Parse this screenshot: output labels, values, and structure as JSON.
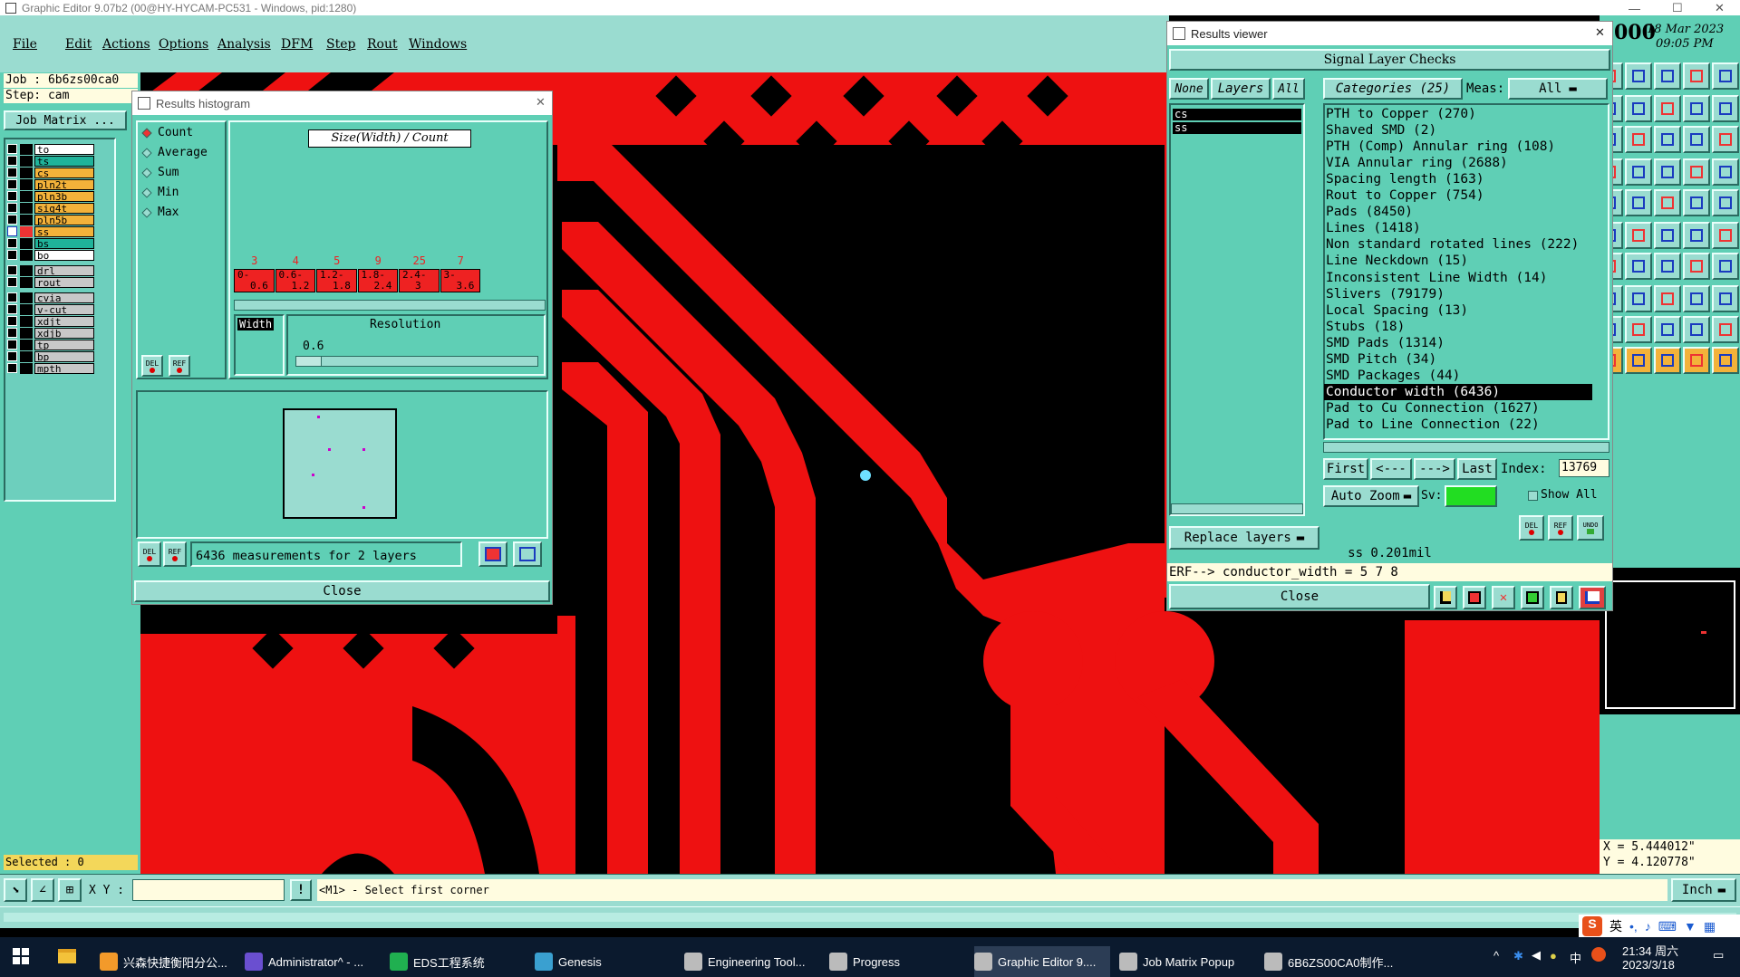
{
  "app": {
    "title": "Graphic Editor 9.07b2 (00@HY-HYCAM-PC531 - Windows, pid:1280)"
  },
  "menu": [
    "File",
    "Edit",
    "Actions",
    "Options",
    "Analysis",
    "DFM",
    "Step",
    "Rout",
    "Windows"
  ],
  "job": {
    "label": "Job :",
    "value": "6b6zs00ca0",
    "step_label": "Step:",
    "step_value": "cam",
    "matrix_label": "Job Matrix ..."
  },
  "layers": [
    {
      "name": "to",
      "color": "#ffffff"
    },
    {
      "name": "ts",
      "color": "#1fb39a"
    },
    {
      "name": "cs",
      "color": "#f3b23a"
    },
    {
      "name": "pln2t",
      "color": "#f3b23a"
    },
    {
      "name": "pln3b",
      "color": "#f3b23a"
    },
    {
      "name": "sig4t",
      "color": "#f3b23a"
    },
    {
      "name": "pln5b",
      "color": "#f3b23a"
    },
    {
      "name": "ss",
      "color": "#f3b23a"
    },
    {
      "name": "bs",
      "color": "#1fb39a"
    },
    {
      "name": "bo",
      "color": "#ffffff"
    },
    {
      "name": "drl",
      "color": "#c8c8c8"
    },
    {
      "name": "rout",
      "color": "#c8c8c8"
    },
    {
      "name": "cvia",
      "color": "#c8c8c8"
    },
    {
      "name": "v-cut",
      "color": "#c8c8c8"
    },
    {
      "name": "xdjt",
      "color": "#c8c8c8"
    },
    {
      "name": "xdjb",
      "color": "#c8c8c8"
    },
    {
      "name": "tp",
      "color": "#c8c8c8"
    },
    {
      "name": "bp",
      "color": "#c8c8c8"
    },
    {
      "name": "mpth",
      "color": "#c8c8c8"
    }
  ],
  "selected": "Selected : 0",
  "histogram": {
    "title": "Results histogram",
    "options": [
      "Count",
      "Average",
      "Sum",
      "Min",
      "Max"
    ],
    "selected_option": "Count",
    "header": "Size(Width) / Count",
    "bins": [
      {
        "count": "3",
        "range1": "0-",
        "range2": "0.6"
      },
      {
        "count": "4",
        "range1": "0.6-",
        "range2": "1.2"
      },
      {
        "count": "5",
        "range1": "1.2-",
        "range2": "1.8"
      },
      {
        "count": "9",
        "range1": "1.8-",
        "range2": "2.4"
      },
      {
        "count": "25",
        "range1": "2.4-",
        "range2": "3"
      },
      {
        "count": "7",
        "range1": "3-",
        "range2": "3.6"
      }
    ],
    "width_label": "Width",
    "resolution_label": "Resolution",
    "resolution_value": "0.6",
    "del": "DEL",
    "ref": "REF",
    "measurements": "6436 measurements for 2 layers",
    "close": "Close"
  },
  "results": {
    "title": "Results viewer",
    "header": "Signal Layer Checks",
    "btn_none": "None",
    "btn_layers": "Layers",
    "btn_all": "All",
    "layers_list": [
      "cs",
      "ss"
    ],
    "categories_label": "Categories (25)",
    "meas_label": "Meas:",
    "meas_value": "All",
    "categories": [
      "PTH to Copper (270)",
      "Shaved SMD (2)",
      "PTH (Comp) Annular ring (108)",
      "VIA Annular ring (2688)",
      "Spacing length (163)",
      "Rout to Copper (754)",
      "Pads (8450)",
      "Lines (1418)",
      "Non standard rotated lines (222)",
      "Line Neckdown (15)",
      "Inconsistent Line Width (14)",
      "Slivers (79179)",
      "Local Spacing (13)",
      "Stubs (18)",
      "SMD Pads (1314)",
      "SMD Pitch (34)",
      "SMD Packages (44)",
      "Conductor width (6436)",
      "Pad to Cu Connection (1627)",
      "Pad to Line Connection (22)"
    ],
    "selected_category": "Conductor width (6436)",
    "first": "First",
    "prev": "<---",
    "next": "--->",
    "last": "Last",
    "index_label": "Index:",
    "index_value": "13769",
    "auto_zoom": "Auto Zoom",
    "sv_label": "Sv:",
    "show_all": "Show All",
    "replace_layers": "Replace layers",
    "del": "DEL",
    "ref": "REF",
    "undo": "UNDO",
    "status": "ss 0.201mil",
    "erf": "ERF--> conductor_width = 5 7 8",
    "close": "Close"
  },
  "clock": {
    "text": "000",
    "date": "18 Mar 2023",
    "time": "09:05 PM"
  },
  "coords": {
    "x": "X = 5.444012\"",
    "y": "Y = 4.120778\""
  },
  "bottom": {
    "xy_label": "X Y :",
    "xy_value": "",
    "prompt": "<M1> - Select first corner",
    "units": "Inch"
  },
  "taskbar": {
    "items": [
      "兴森快捷衡阳分公...",
      "Administrator^ - ...",
      "EDS工程系统",
      "Genesis",
      "Engineering Tool...",
      "Progress",
      "Graphic Editor 9....",
      "Job Matrix Popup",
      "6B6ZS00CA0制作..."
    ],
    "ime": "英",
    "ime2": "中",
    "time": "21:34 周六",
    "date": "2023/3/18"
  },
  "colors": {
    "teal": "#5fcfb5",
    "light_teal": "#9adcd0",
    "copper": "#ee1111",
    "accent_orange": "#f3b23a"
  }
}
